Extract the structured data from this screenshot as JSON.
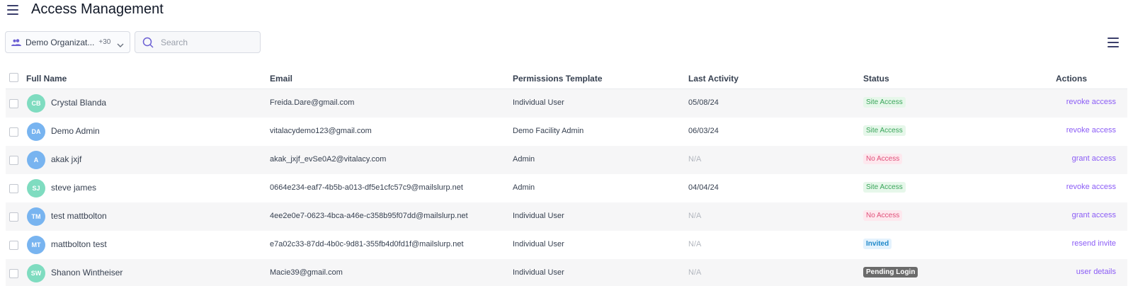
{
  "header": {
    "title": "Access Management"
  },
  "toolbar": {
    "org_label": "Demo Organizat...",
    "org_count": "+30",
    "search_placeholder": "Search"
  },
  "columns": {
    "full_name": "Full Name",
    "email": "Email",
    "template": "Permissions Template",
    "last_activity": "Last Activity",
    "status": "Status",
    "actions": "Actions"
  },
  "colors": {
    "accent": "#8b5cf6",
    "site_access_bg": "#e6f7ea",
    "site_access_fg": "#3aa55a",
    "no_access_bg": "#fde8ee",
    "no_access_fg": "#e0507a",
    "invited_bg": "#e3f2fd",
    "invited_fg": "#1e88c9",
    "pending_bg": "#6b6b6b",
    "pending_fg": "#ffffff",
    "avatar_green": "#7fdcc0",
    "avatar_blue": "#78b4f0"
  },
  "rows": [
    {
      "initials": "CB",
      "name": "Crystal Blanda",
      "email": "Freida.Dare@gmail.com",
      "template": "Individual User",
      "last_activity": "05/08/24",
      "status": "Site Access",
      "status_type": "site",
      "action": "revoke access",
      "avatar_color": "green"
    },
    {
      "initials": "DA",
      "name": "Demo Admin",
      "email": "vitalacydemo123@gmail.com",
      "template": "Demo Facility Admin",
      "last_activity": "06/03/24",
      "status": "Site Access",
      "status_type": "site",
      "action": "revoke access",
      "avatar_color": "blue"
    },
    {
      "initials": "A",
      "name": "akak jxjf",
      "email": "akak_jxjf_evSe0A2@vitalacy.com",
      "template": "Admin",
      "last_activity": "N/A",
      "status": "No Access",
      "status_type": "no",
      "action": "grant access",
      "avatar_color": "blue"
    },
    {
      "initials": "SJ",
      "name": "steve james",
      "email": "0664e234-eaf7-4b5b-a013-df5e1cfc57c9@mailslurp.net",
      "template": "Admin",
      "last_activity": "04/04/24",
      "status": "Site Access",
      "status_type": "site",
      "action": "revoke access",
      "avatar_color": "green"
    },
    {
      "initials": "TM",
      "name": "test mattbolton",
      "email": "4ee2e0e7-0623-4bca-a46e-c358b95f07dd@mailslurp.net",
      "template": "Individual User",
      "last_activity": "N/A",
      "status": "No Access",
      "status_type": "no",
      "action": "grant access",
      "avatar_color": "blue"
    },
    {
      "initials": "MT",
      "name": "mattbolton test",
      "email": "e7a02c33-87dd-4b0c-9d81-355fb4d0fd1f@mailslurp.net",
      "template": "Individual User",
      "last_activity": "N/A",
      "status": "Invited",
      "status_type": "invited",
      "action": "resend invite",
      "avatar_color": "blue"
    },
    {
      "initials": "SW",
      "name": "Shanon Wintheiser",
      "email": "Macie39@gmail.com",
      "template": "Individual User",
      "last_activity": "N/A",
      "status": "Pending Login",
      "status_type": "pending",
      "action": "user details",
      "avatar_color": "green"
    }
  ]
}
